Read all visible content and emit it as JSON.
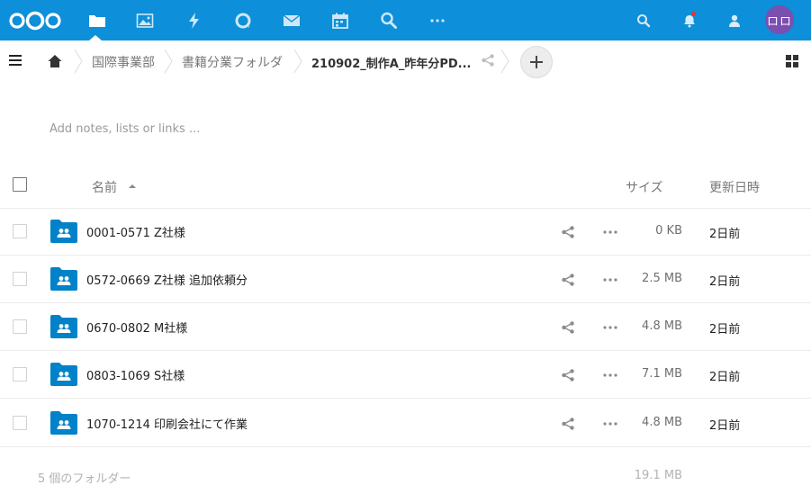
{
  "header": {
    "apps": [
      {
        "name": "files",
        "icon": "folder-icon",
        "active": true
      },
      {
        "name": "photos",
        "icon": "image-icon"
      },
      {
        "name": "activity",
        "icon": "lightning-icon"
      },
      {
        "name": "talk",
        "icon": "chat-bubble-icon"
      },
      {
        "name": "mail",
        "icon": "envelope-icon"
      },
      {
        "name": "calendar",
        "icon": "calendar-icon"
      },
      {
        "name": "search-app",
        "icon": "magnifier-person-icon"
      },
      {
        "name": "more-apps",
        "icon": "more-dots-icon"
      }
    ],
    "avatar_initials": "ロロ",
    "accent_color": "#0d8fd9",
    "avatar_color": "#7a4fb0"
  },
  "breadcrumb": {
    "items": [
      "国際事業部",
      "書籍分業フォルダ",
      "210902_制作A_昨年分PD..."
    ]
  },
  "notes_placeholder": "Add notes, lists or links ...",
  "table": {
    "columns": {
      "name": "名前",
      "size": "サイズ",
      "modified": "更新日時"
    },
    "rows": [
      {
        "name": "0001-0571 Z社様",
        "size": "0 KB",
        "modified": "2日前"
      },
      {
        "name": "0572-0669 Z社様 追加依頼分",
        "size": "2.5 MB",
        "modified": "2日前"
      },
      {
        "name": "0670-0802 M社様",
        "size": "4.8 MB",
        "modified": "2日前"
      },
      {
        "name": "0803-1069 S社様",
        "size": "7.1 MB",
        "modified": "2日前"
      },
      {
        "name": "1070-1214 印刷会社にて作業",
        "size": "4.8 MB",
        "modified": "2日前"
      }
    ],
    "summary": {
      "count_label": "5 個のフォルダー",
      "total_size": "19.1 MB"
    }
  }
}
